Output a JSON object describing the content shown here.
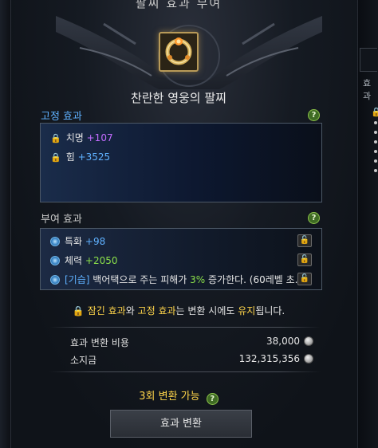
{
  "window": {
    "title": "팔찌 효과 부여",
    "item_name": "찬란한 영웅의 팔찌"
  },
  "fixed_effects": {
    "title": "고정 효과",
    "rows": [
      {
        "name": "치명",
        "value": "+107",
        "color": "#c36cff"
      },
      {
        "name": "힘",
        "value": "+3525",
        "color": "#5fb1ff"
      }
    ]
  },
  "granted_effects": {
    "title": "부여 효과",
    "rows": [
      {
        "name": "특화",
        "value": "+98",
        "color": "#5fb1ff"
      },
      {
        "name": "체력",
        "value": "+2050",
        "color": "#8be04a"
      },
      {
        "tag": "[기습]",
        "text_a": "백어택으로 주는 피해가 ",
        "highlight": "3%",
        "text_b": " 증가한다. (60레벨 초..."
      }
    ]
  },
  "note": {
    "part1": "잠긴 효과",
    "part2": "와 ",
    "part3": "고정 효과",
    "part4": "는 변환 시에도 ",
    "part5": "유지",
    "part6": "됩니다."
  },
  "costs": {
    "change_cost_label": "효과 변환 비용",
    "change_cost_value": "38,000",
    "owned_label": "소지금",
    "owned_value": "132,315,356"
  },
  "remaining": "3회 변환 가능",
  "action_button": "효과 변환",
  "right_panel": {
    "label": "효과"
  },
  "help_icon": "?"
}
